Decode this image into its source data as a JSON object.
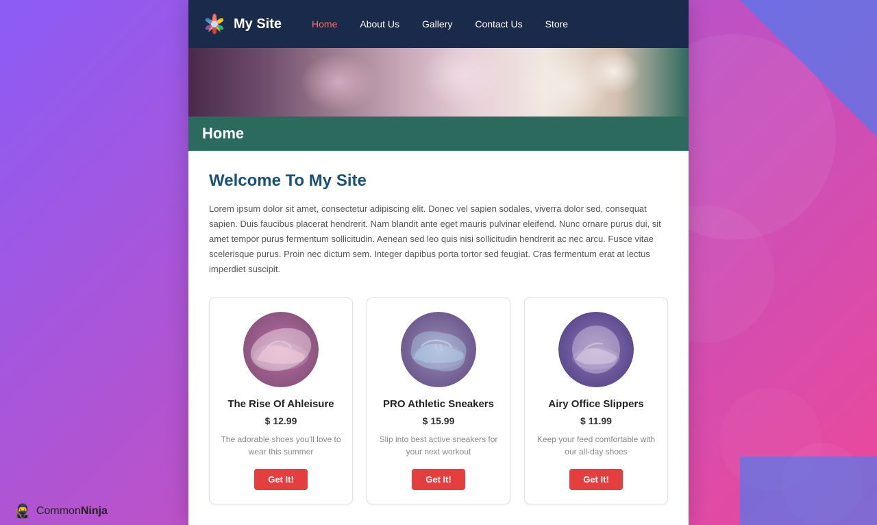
{
  "brand": {
    "name": "My Site",
    "logo_alt": "colorful gem logo"
  },
  "navbar": {
    "items": [
      {
        "label": "Home",
        "active": true
      },
      {
        "label": "About Us",
        "active": false
      },
      {
        "label": "Gallery",
        "active": false
      },
      {
        "label": "Contact Us",
        "active": false
      },
      {
        "label": "Store",
        "active": false
      }
    ]
  },
  "hero": {
    "alt": "Flowers hero image"
  },
  "page_title": "Home",
  "welcome": {
    "title": "Welcome To My Site",
    "intro": "Lorem ipsum dolor sit amet, consectetur adipiscing elit. Donec vel sapien sodales, viverra dolor sed, consequat sapien. Duis faucibus placerat hendrerit. Nam blandit ante eget mauris pulvinar eleifend. Nunc ornare purus dui, sit amet tempor purus fermentum sollicitudin. Aenean sed leo quis nisi sollicitudin hendrerit ac nec arcu. Fusce vitae scelerisque purus. Proin nec dictum sem. Integer dapibus porta tortor sed feugiat. Cras fermentum erat at lectus imperdiet suscipit."
  },
  "products": [
    {
      "name": "The Rise Of Ahleisure",
      "price": "$ 12.99",
      "description": "The adorable shoes you'll love to wear this summer",
      "button_label": "Get It!"
    },
    {
      "name": "PRO Athletic Sneakers",
      "price": "$ 15.99",
      "description": "Slip into best active sneakers for your next workout",
      "button_label": "Get It!"
    },
    {
      "name": "Airy Office Slippers",
      "price": "$ 11.99",
      "description": "Keep your feed comfortable with our all-day shoes",
      "button_label": "Get It!"
    }
  ],
  "footer": {
    "brand": "CommonNinja",
    "icon": "🥷"
  }
}
